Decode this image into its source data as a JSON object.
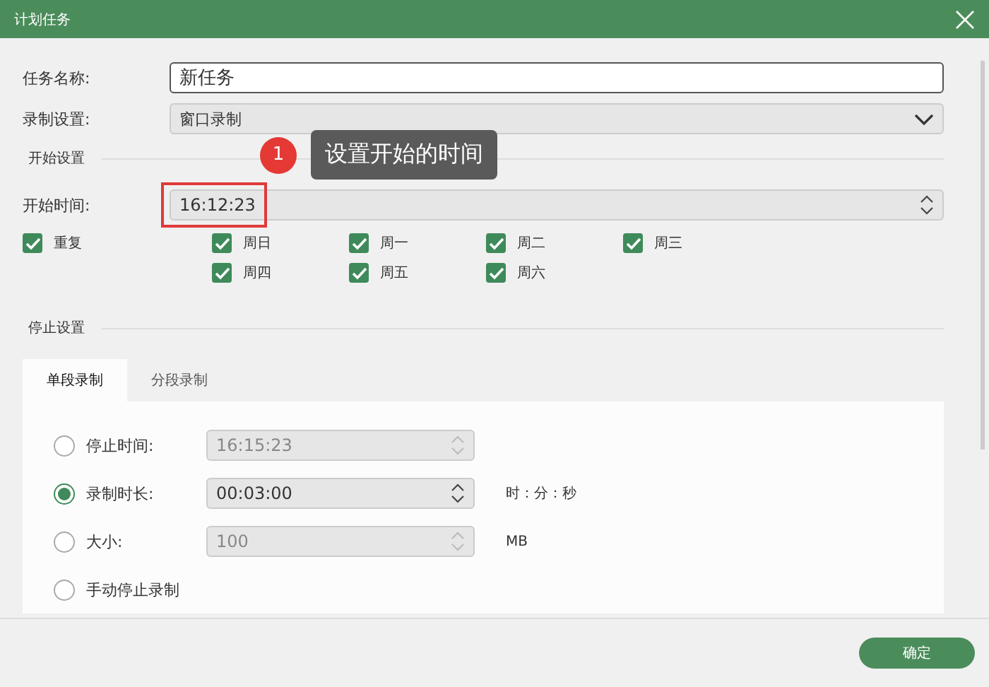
{
  "window": {
    "title": "计划任务"
  },
  "task_name": {
    "label": "任务名称:",
    "value": "新任务"
  },
  "record_setting": {
    "label": "录制设置:",
    "value": "窗口录制"
  },
  "start_section": {
    "title": "开始设置"
  },
  "annotation": {
    "number": "1",
    "text": "设置开始的时间"
  },
  "start_time": {
    "label": "开始时间:",
    "value": "16:12:23"
  },
  "repeat": {
    "label": "重复",
    "checked": true
  },
  "days": [
    {
      "label": "周日",
      "checked": true
    },
    {
      "label": "周一",
      "checked": true
    },
    {
      "label": "周二",
      "checked": true
    },
    {
      "label": "周三",
      "checked": true
    },
    {
      "label": "周四",
      "checked": true
    },
    {
      "label": "周五",
      "checked": true
    },
    {
      "label": "周六",
      "checked": true
    }
  ],
  "stop_section": {
    "title": "停止设置"
  },
  "tabs": [
    {
      "label": "单段录制",
      "selected": true
    },
    {
      "label": "分段录制",
      "selected": false
    }
  ],
  "stop_options": [
    {
      "label": "停止时间:",
      "selected": false,
      "value": "16:15:23",
      "disabled": true
    },
    {
      "label": "录制时长:",
      "selected": true,
      "value": "00:03:00",
      "disabled": false,
      "unit": "时：分：秒"
    },
    {
      "label": "大小:",
      "selected": false,
      "value": "100",
      "disabled": true,
      "unit": "MB"
    },
    {
      "label": "手动停止录制",
      "selected": false
    }
  ],
  "buttons": [
    {
      "label": "确定"
    }
  ]
}
